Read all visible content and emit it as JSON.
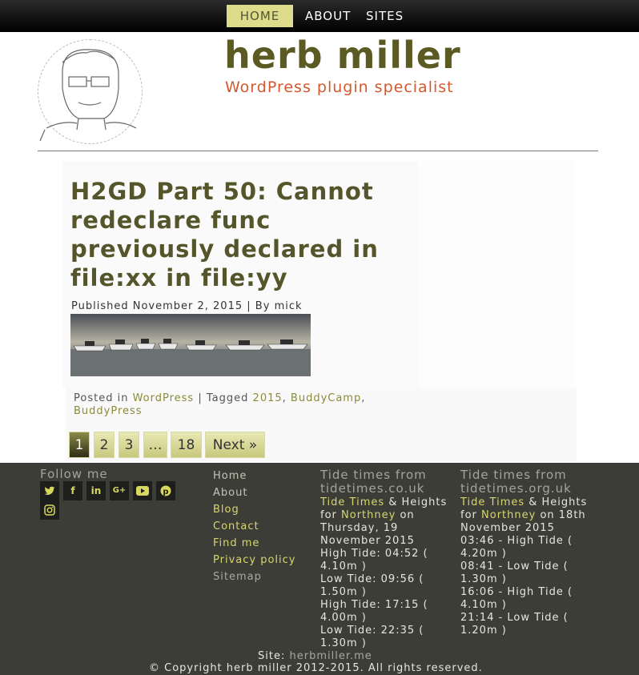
{
  "nav": {
    "items": [
      "HOME",
      "ABOUT",
      "SITES"
    ]
  },
  "header": {
    "title": "herb miller",
    "tagline": "WordPress plugin specialist"
  },
  "post": {
    "title": "H2GD Part 50: Cannot redeclare func previously declared in file:xx in file:yy",
    "meta": {
      "published_label": "Published",
      "date": "November 2, 2015",
      "separator": "|",
      "by_label": "By",
      "author": "mick"
    },
    "footer": {
      "posted_label": "Posted in",
      "category": "WordPress",
      "separator": "|",
      "tagged_label": "Tagged",
      "tags": [
        "2015",
        "BuddyCamp",
        "BuddyPress"
      ]
    }
  },
  "pagination": {
    "pages": [
      "1",
      "2",
      "3",
      "…",
      "18"
    ],
    "current": "1",
    "next_label": "Next »"
  },
  "footer": {
    "follow_title": "Follow me",
    "social_icons": [
      "twitter-icon",
      "facebook-icon",
      "linkedin-icon",
      "google-plus-icon",
      "youtube-icon",
      "pinterest-icon",
      "instagram-icon"
    ],
    "links": [
      "Home",
      "About",
      "Blog",
      "Contact",
      "Find me",
      "Privacy policy",
      "Sitemap"
    ],
    "tide1": {
      "title": "Tide times from tidetimes.co.uk",
      "link1": "Tide Times",
      "text1": "& Heights for",
      "link2": "Northney",
      "text2": "on Thursday, 19 November 2015",
      "lines": [
        "High Tide: 04:52 ( 4.10m )",
        "Low Tide: 09:56 ( 1.50m )",
        "High Tide: 17:15 ( 4.00m )",
        "Low Tide: 22:35 ( 1.30m )"
      ]
    },
    "tide2": {
      "title": "Tide times from tidetimes.org.uk",
      "link1": "Tide Times",
      "text1": "& Heights for",
      "link2": "Northney",
      "text2": "on 18th November 2015",
      "lines": [
        "03:46 - High Tide ( 4.20m )",
        "08:41 - Low Tide ( 1.30m )",
        "16:06 - High Tide ( 4.10m )",
        "21:14 - Low Tide ( 1.20m )"
      ]
    },
    "site_label": "Site:",
    "site_url": "herbmiller.me",
    "copyright": "© Copyright herb miller 2012-2015. All rights reserved."
  },
  "colors": {
    "olive_title": "#5a5a22",
    "tagline_orange": "#d4582c",
    "accent_yellow": "#d6d670",
    "footer_bg": "#3d3d38",
    "nav_active": "#dcdc8c"
  }
}
